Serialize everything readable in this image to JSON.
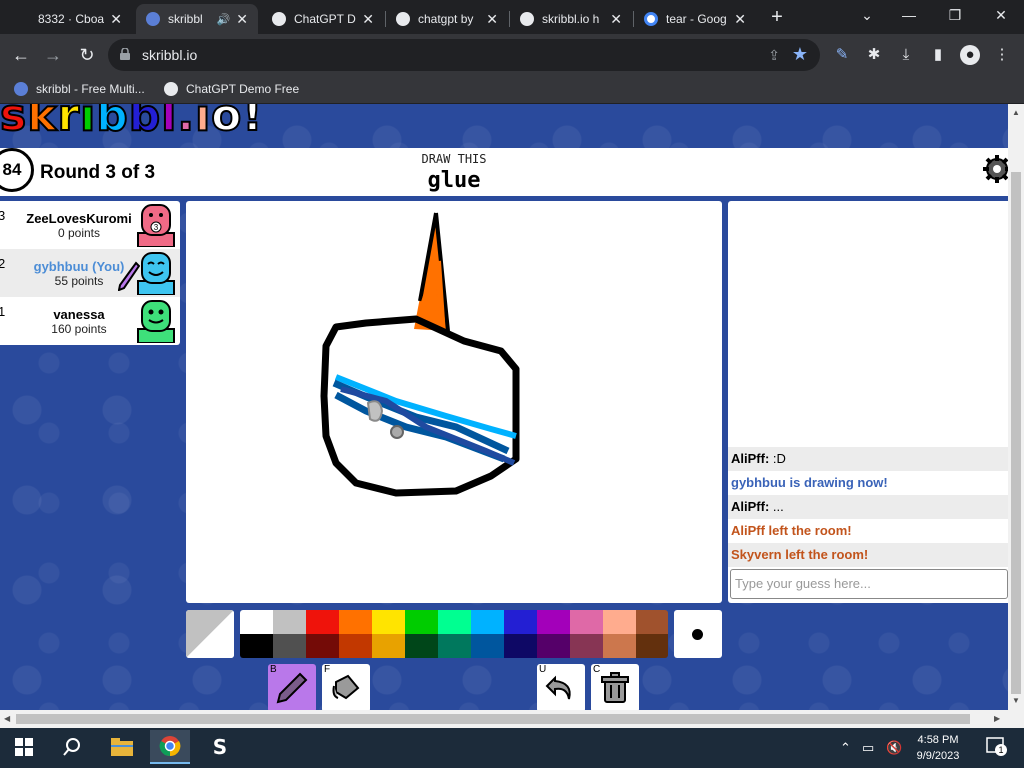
{
  "browser": {
    "tabs": [
      {
        "title": "8332 · Cboa",
        "favicon_color": "#ffffff"
      },
      {
        "title": "skribbl",
        "favicon_color": "#5b7fd6",
        "active": true
      },
      {
        "title": "ChatGPT D",
        "favicon_color": "#e8eaed"
      },
      {
        "title": "chatgpt by",
        "favicon_color": "#e8eaed"
      },
      {
        "title": "skribbl.io h",
        "favicon_color": "#e8eaed"
      },
      {
        "title": "tear - Goog",
        "favicon_color": "#ffffff"
      }
    ],
    "url": "skribbl.io",
    "bookmarks": [
      "skribbl - Free Multi...",
      "ChatGPT Demo Free"
    ]
  },
  "game": {
    "timer": "84",
    "round": "Round 3 of 3",
    "draw_label": "DRAW THIS",
    "word": "glue",
    "players": [
      {
        "rank": "3",
        "name": "ZeeLovesKuromi",
        "points": "0 points",
        "avatar_color": "#f06a86",
        "badge": "3"
      },
      {
        "rank": "2",
        "name": "gybhbuu (You)",
        "points": "55 points",
        "avatar_color": "#3ec5f0",
        "you": true
      },
      {
        "rank": "1",
        "name": "vanessa",
        "points": "160 points",
        "avatar_color": "#3ee07a"
      }
    ],
    "chat": [
      {
        "who": "AliPff:",
        "text": ":D"
      },
      {
        "system": "gybhbuu is drawing now!",
        "color": "blue"
      },
      {
        "who": "AliPff:",
        "text": "..."
      },
      {
        "system": "AliPff left the room!",
        "color": "red"
      },
      {
        "system": "Skyvern left the room!",
        "color": "red"
      }
    ],
    "guess_placeholder": "Type your guess here...",
    "palette": [
      "#ffffff",
      "#c1c1c1",
      "#ef130b",
      "#ff7100",
      "#ffe400",
      "#00cc00",
      "#00ff91",
      "#00b2ff",
      "#231fd3",
      "#a300ba",
      "#df69a7",
      "#ffac8e",
      "#a0522d",
      "#000000",
      "#505050",
      "#740b07",
      "#c23800",
      "#e8a200",
      "#004619",
      "#00785d",
      "#00569e",
      "#0e0865",
      "#550069",
      "#873554",
      "#cc774d",
      "#63300d"
    ],
    "tools": {
      "brush_key": "B",
      "fill_key": "F",
      "undo_key": "U",
      "clear_key": "C"
    }
  },
  "taskbar": {
    "time": "4:58 PM",
    "date": "9/9/2023",
    "notifications": "1"
  }
}
